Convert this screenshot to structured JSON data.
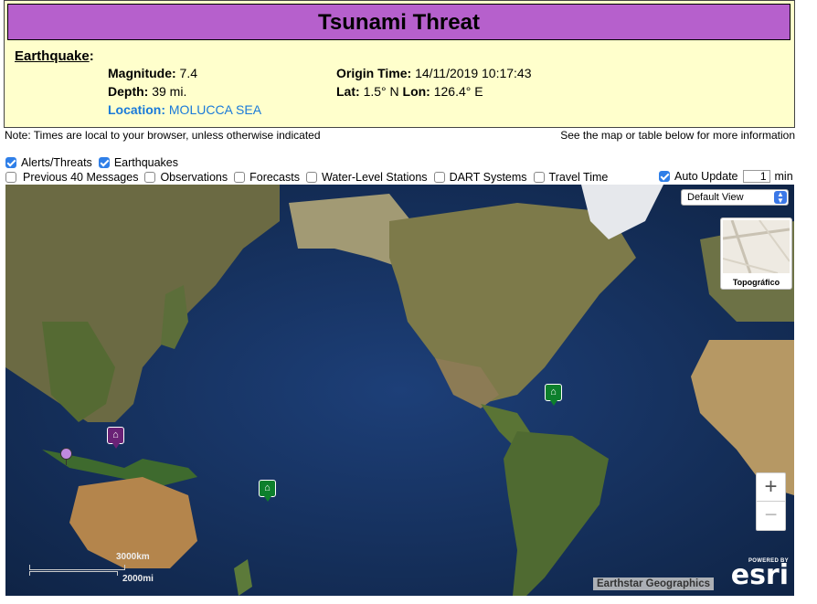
{
  "header": {
    "title": "Tsunami Threat"
  },
  "earthquake": {
    "heading": "Earthquake",
    "colon": ":",
    "magnitude_label": "Magnitude:",
    "magnitude_value": "7.4",
    "depth_label": "Depth:",
    "depth_value": "39 mi.",
    "location_label": "Location:",
    "location_value": "MOLUCCA SEA",
    "origin_label": "Origin Time:",
    "origin_value": "14/11/2019 10:17:43",
    "lat_label": "Lat:",
    "lat_value": "1.5° N",
    "lon_label": "Lon:",
    "lon_value": "126.4° E"
  },
  "notes": {
    "left": "Note: Times are local to your browser, unless otherwise indicated",
    "right": "See the map or table below for more information"
  },
  "layers": {
    "alerts": {
      "label": "Alerts/Threats",
      "checked": true
    },
    "earthquakes": {
      "label": "Earthquakes",
      "checked": true
    },
    "previous": {
      "label": "Previous 40 Messages",
      "checked": false
    },
    "observations": {
      "label": "Observations",
      "checked": false
    },
    "forecasts": {
      "label": "Forecasts",
      "checked": false
    },
    "water_level": {
      "label": "Water-Level Stations",
      "checked": false
    },
    "dart": {
      "label": "DART Systems",
      "checked": false
    },
    "travel_time": {
      "label": "Travel Time",
      "checked": false
    }
  },
  "auto_update": {
    "label": "Auto Update",
    "checked": true,
    "value": "1",
    "unit": "min"
  },
  "map": {
    "view_select": "Default View",
    "basemap_label": "Topográfico",
    "zoom_in": "+",
    "zoom_out": "−",
    "scale_km": "3000km",
    "scale_mi": "2000mi",
    "attribution": "Earthstar Geographics",
    "powered_by": "POWERED BY",
    "esri": "esri"
  },
  "colors": {
    "title_bar": "#b660cc",
    "info_panel": "#ffffcc",
    "location_link": "#1a7ad9",
    "ocean": "#17305a",
    "threat_marker": "#0d7f2c",
    "event_marker": "#6a2276"
  },
  "icons": {
    "checkbox": "check-icon",
    "select_arrow": "updown-chevron-icon",
    "tsunami_marker": "tsunami-wave-icon",
    "quake_pin": "map-pin-icon"
  }
}
